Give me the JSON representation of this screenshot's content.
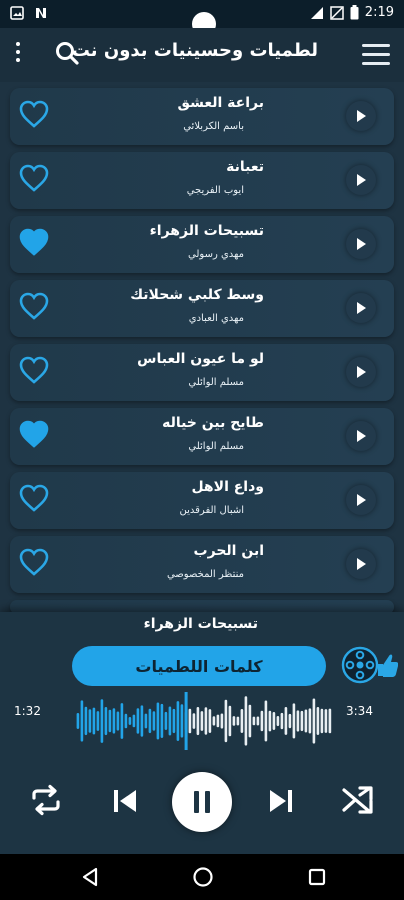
{
  "status_bar": {
    "time": "2:19"
  },
  "header": {
    "title": "لطميات وحسينيات بدون نت",
    "menu_icon": "hamburger-menu-icon",
    "search_icon": "search-icon",
    "more_icon": "more-vertical-icon"
  },
  "tracks": [
    {
      "name": "براعة العشق",
      "artist": "باسم الكربلائي",
      "favorite": false
    },
    {
      "name": "تعبانة",
      "artist": "ايوب الفريجي",
      "favorite": false
    },
    {
      "name": "تسبيحات الزهراء",
      "artist": "مهدي رسولي",
      "favorite": true
    },
    {
      "name": "وسط كلبي شحلاتك",
      "artist": "مهدي العبادي",
      "favorite": false
    },
    {
      "name": "لو ما عيون العباس",
      "artist": "مسلم الوائلي",
      "favorite": false
    },
    {
      "name": "طايح بين خياله",
      "artist": "مسلم الوائلي",
      "favorite": true
    },
    {
      "name": "وداع الاهل",
      "artist": "اشبال الفرقدين",
      "favorite": false
    },
    {
      "name": "ابن الحرب",
      "artist": "منتظر المخصوصي",
      "favorite": false
    }
  ],
  "player": {
    "now_playing": "تسبيحات الزهراء",
    "lyrics_button": "كلمات اللطميات",
    "elapsed": "1:32",
    "duration": "3:34",
    "progress": 0.43
  },
  "colors": {
    "accent": "#22a4e8",
    "background": "#1e3342",
    "row": "#243f52"
  }
}
